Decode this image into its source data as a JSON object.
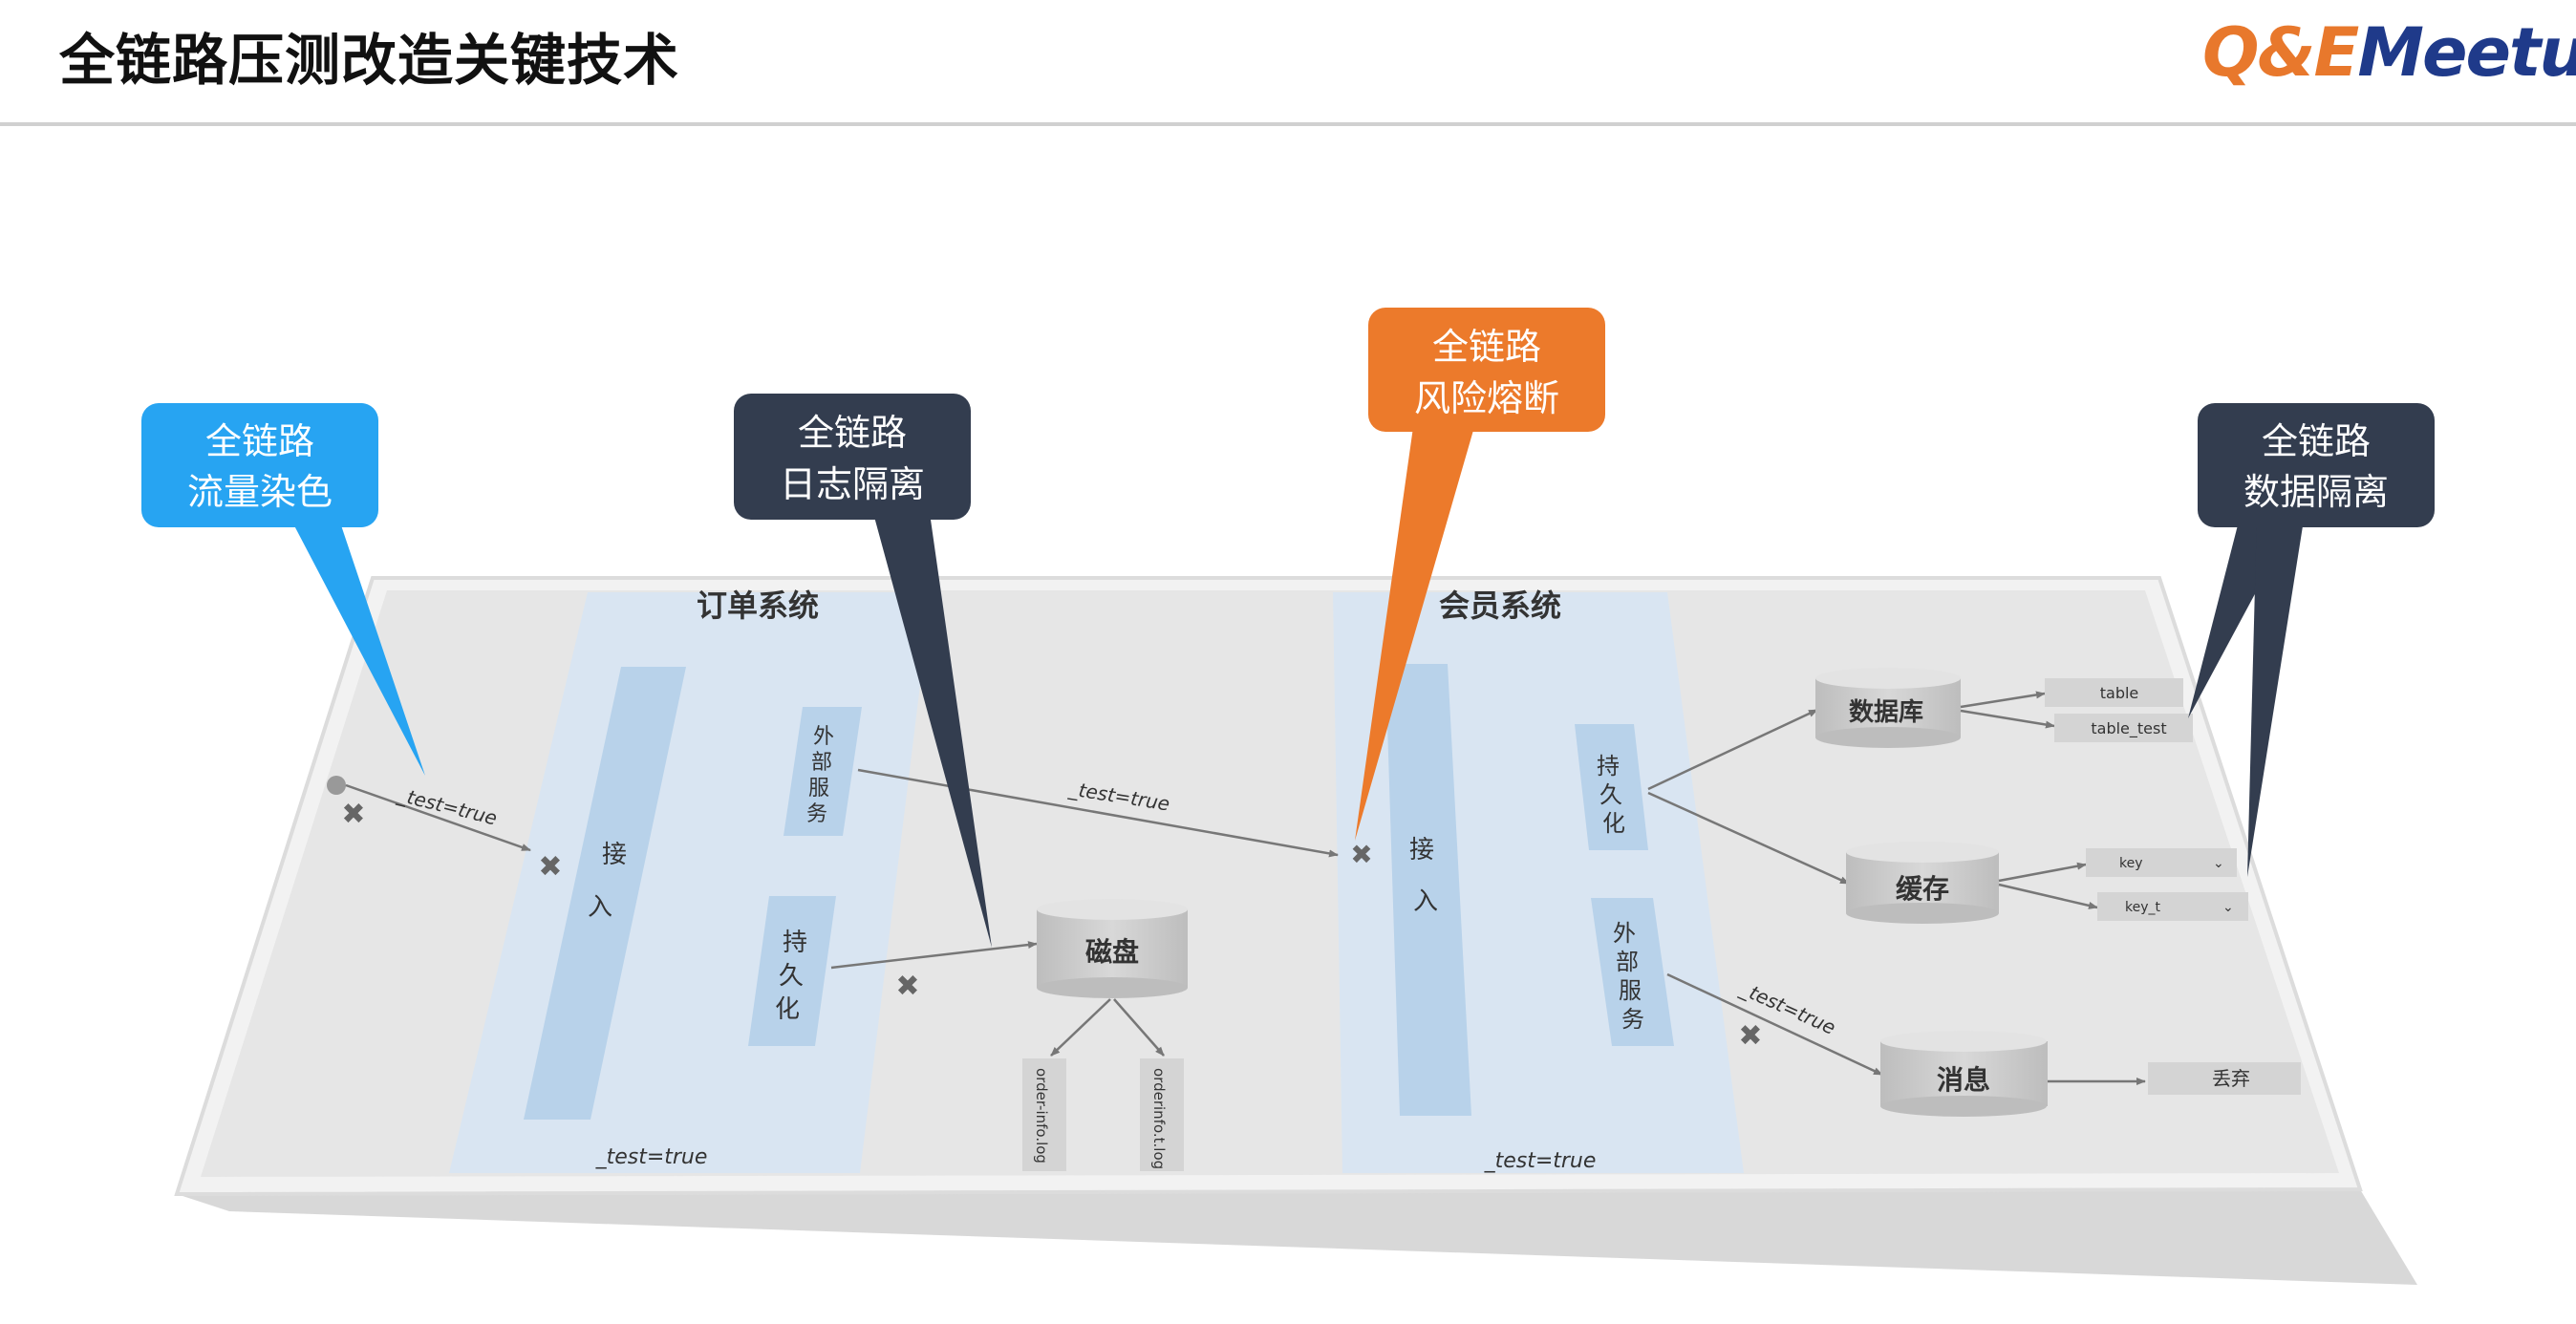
{
  "page": {
    "title": "全链路压测改造关键技术",
    "logo": {
      "part1": "Q&E",
      "part2": "Meetup"
    }
  },
  "callouts": [
    {
      "line1": "全链路",
      "line2": "流量染色",
      "color": "#27a4f2"
    },
    {
      "line1": "全链路",
      "line2": "日志隔离",
      "color": "#333d4f"
    },
    {
      "line1": "全链路",
      "line2": "风险熔断",
      "color": "#ec7a2b"
    },
    {
      "line1": "全链路",
      "line2": "数据隔离",
      "color": "#333d4f"
    }
  ],
  "diagram": {
    "order_system": {
      "label": "订单系统",
      "access": [
        "接",
        "入"
      ],
      "external": [
        "外",
        "部",
        "服",
        "务"
      ],
      "persist": [
        "持",
        "久",
        "化"
      ],
      "footer": "_test=true"
    },
    "member_system": {
      "label": "会员系统",
      "access": [
        "接",
        "入"
      ],
      "persist": [
        "持",
        "久",
        "化"
      ],
      "external": [
        "外",
        "部",
        "服",
        "务"
      ],
      "footer": "_test=true"
    },
    "disk": {
      "label": "磁盘",
      "logs": [
        "order-info.log",
        "orderinfo.t.log"
      ]
    },
    "database": {
      "label": "数据库",
      "tables": [
        "table",
        "table_test"
      ]
    },
    "cache": {
      "label": "缓存",
      "keys": [
        "key",
        "key_t"
      ]
    },
    "message": {
      "label": "消息",
      "target": "丢弃"
    },
    "edge_labels": {
      "entry": "_test=true",
      "cross": "_test=true",
      "member_ext": "_test=true"
    },
    "colors": {
      "board": "#e6e6e6",
      "system_band": "#d8e4f1",
      "bar": "#b7d2ea",
      "cylinder": "#cfcfcf",
      "arrow": "#777777",
      "cross": "#666666"
    }
  }
}
